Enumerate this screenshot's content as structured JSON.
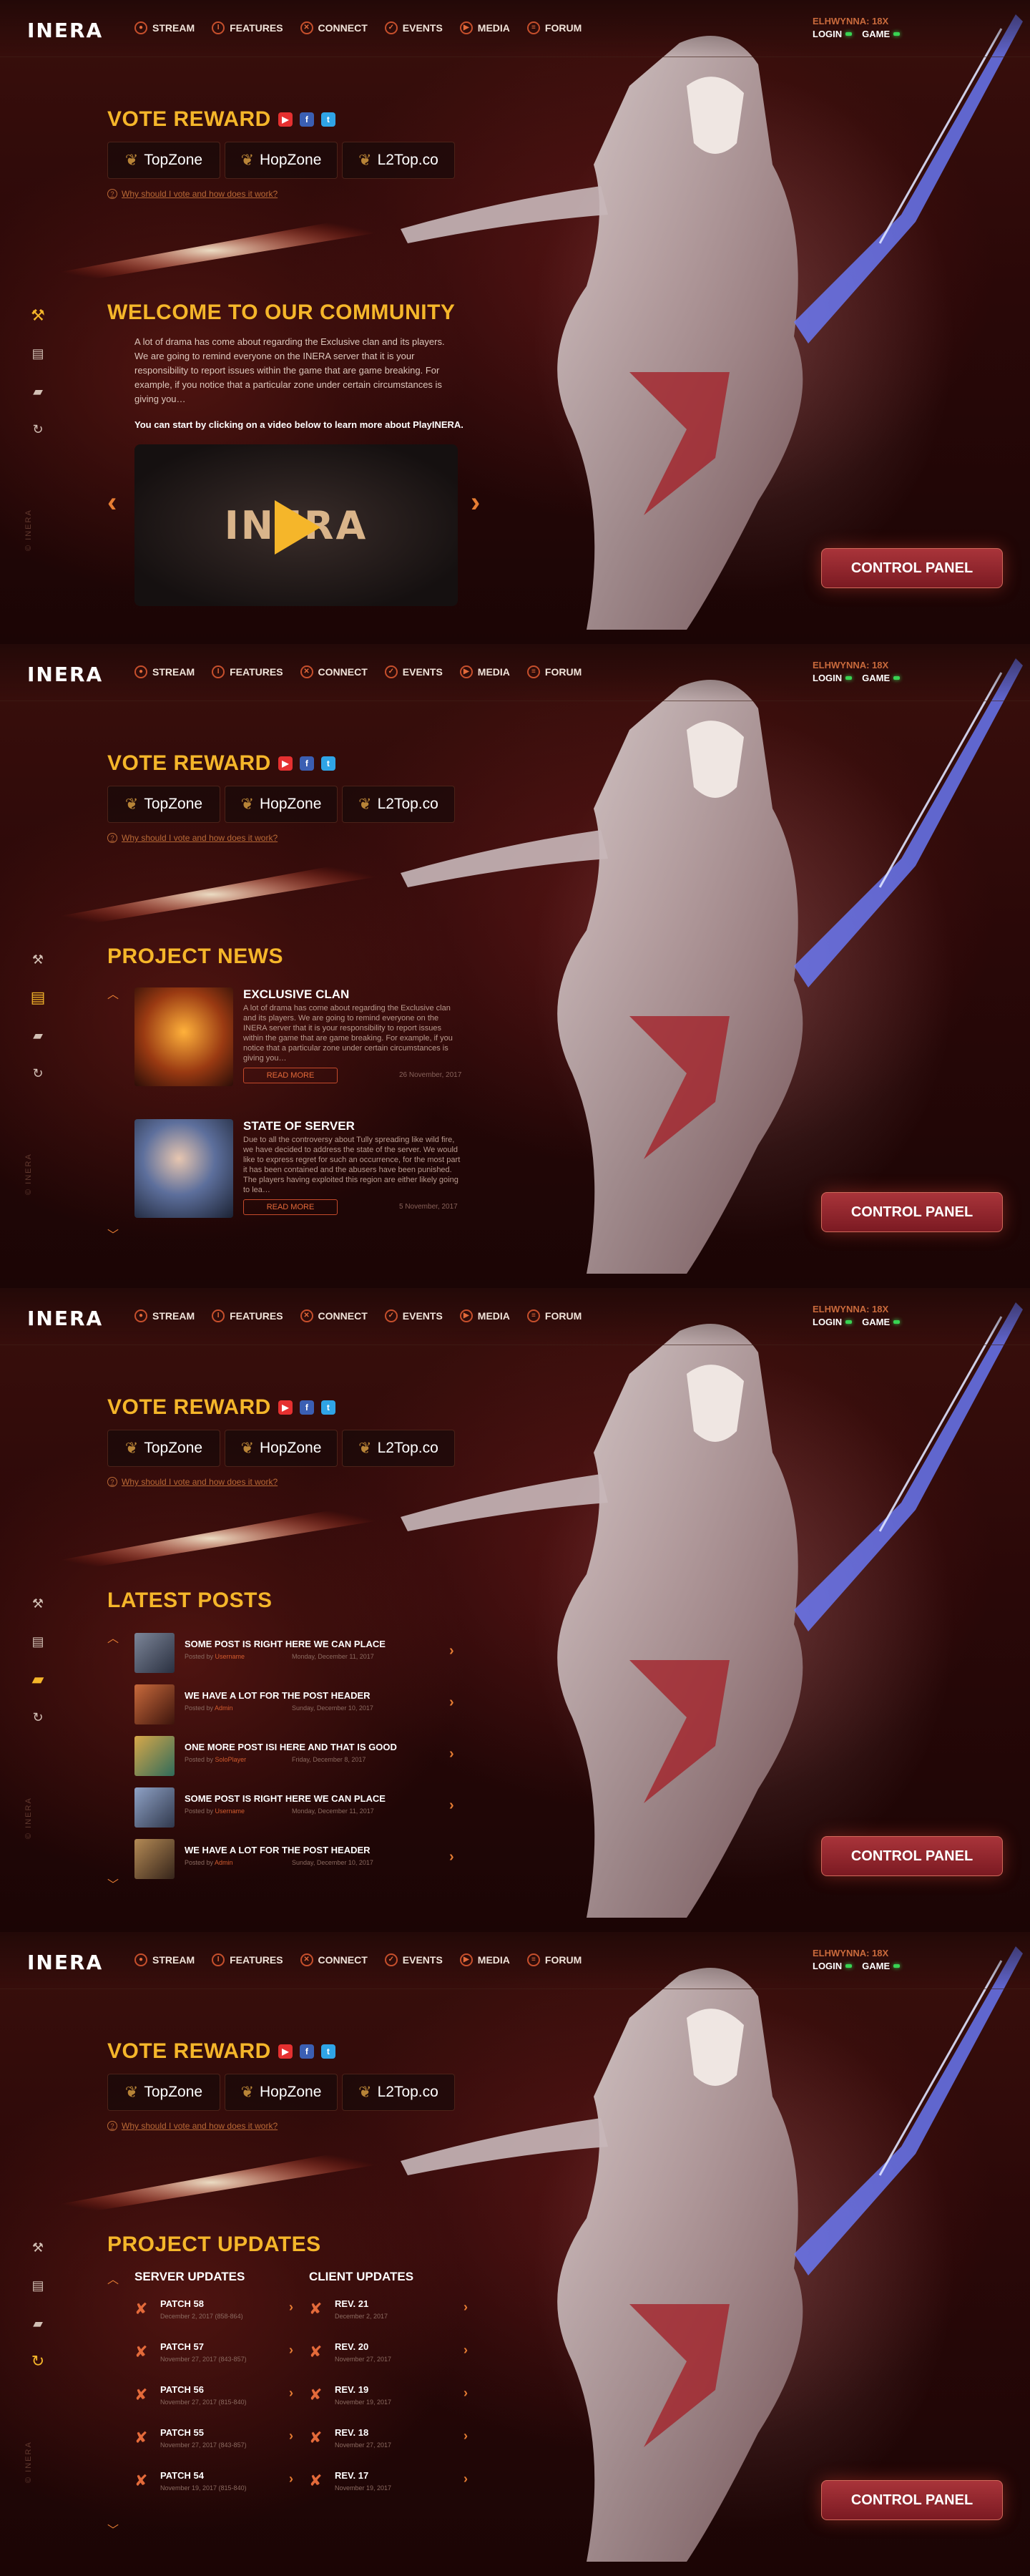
{
  "brand": {
    "logo": "INERA",
    "accent": "#f5b62a",
    "accent_orange": "#e67d33",
    "status_green": "#39d353"
  },
  "header": {
    "nav": [
      {
        "label": "STREAM",
        "icon": "stream-icon"
      },
      {
        "label": "FEATURES",
        "icon": "info-icon"
      },
      {
        "label": "CONNECT",
        "icon": "connect-icon"
      },
      {
        "label": "EVENTS",
        "icon": "events-icon"
      },
      {
        "label": "MEDIA",
        "icon": "media-icon"
      },
      {
        "label": "FORUM",
        "icon": "forum-icon"
      }
    ],
    "server": {
      "name": "ELHWYNNA: 18X",
      "login": "LOGIN",
      "game": "GAME"
    }
  },
  "vote": {
    "title": "VOTE REWARD",
    "sites": [
      "TopZone",
      "HopZone",
      "L2Top.co"
    ],
    "help": "Why should I vote and how does it work?"
  },
  "control_panel": "CONTROL PANEL",
  "copyright": "© INERA",
  "community": {
    "title": "WELCOME TO OUR COMMUNITY",
    "text": "A lot of drama has come about regarding the Exclusive clan and its players. We are going to remind everyone on the INERA server that it is your responsibility to report issues within the game that are game breaking. For example, if you notice that a particular zone under certain circumstances is giving you…",
    "cta": "You can start by clicking on a video below to learn more about PlayINERA.",
    "video_brand": "INERA"
  },
  "news": {
    "title": "PROJECT NEWS",
    "items": [
      {
        "title": "EXCLUSIVE CLAN",
        "text": "A lot of drama has come about regarding the Exclusive clan and its players. We are going to remind everyone on the INERA server that it is your responsibility to report issues within the game that are game breaking. For example, if you notice that a particular zone under certain circumstances is giving you…",
        "button": "READ MORE",
        "date": "26 November, 2017"
      },
      {
        "title": "STATE OF SERVER",
        "text": "Due to all the controversy about Tully spreading like wild fire, we have decided to address the state of the server. We would like to express regret for such an occurrence, for the most part it has been contained and the abusers have been punished. The players having exploited this region are either likely going to lea…",
        "button": "READ MORE",
        "date": "5 November, 2017"
      }
    ]
  },
  "posts": {
    "title": "LATEST POSTS",
    "posted_by": "Posted by",
    "items": [
      {
        "title": "SOME POST IS RIGHT HERE WE CAN PLACE",
        "author": "Username",
        "date": "Monday, December 11, 2017"
      },
      {
        "title": "WE HAVE A LOT FOR THE POST HEADER",
        "author": "Admin",
        "date": "Sunday, December 10, 2017"
      },
      {
        "title": "ONE MORE POST ISI HERE AND THAT IS GOOD",
        "author": "SoloPlayer",
        "date": "Friday, December 8, 2017"
      },
      {
        "title": "SOME POST IS RIGHT HERE WE CAN PLACE",
        "author": "Username",
        "date": "Monday, December 11, 2017"
      },
      {
        "title": "WE HAVE A LOT FOR THE POST HEADER",
        "author": "Admin",
        "date": "Sunday, December 10, 2017"
      }
    ]
  },
  "updates": {
    "title": "PROJECT UPDATES",
    "server_label": "SERVER UPDATES",
    "client_label": "CLIENT UPDATES",
    "server": [
      {
        "name": "PATCH 58",
        "date": "December 2, 2017 (858-864)"
      },
      {
        "name": "PATCH 57",
        "date": "November 27, 2017 (843-857)"
      },
      {
        "name": "PATCH 56",
        "date": "November 27, 2017 (815-840)"
      },
      {
        "name": "PATCH 55",
        "date": "November 27, 2017 (843-857)"
      },
      {
        "name": "PATCH 54",
        "date": "November 19, 2017 (815-840)"
      }
    ],
    "client": [
      {
        "name": "REV. 21",
        "date": "December 2, 2017"
      },
      {
        "name": "REV. 20",
        "date": "November 27, 2017"
      },
      {
        "name": "REV. 19",
        "date": "November 19, 2017"
      },
      {
        "name": "REV. 18",
        "date": "November 27, 2017"
      },
      {
        "name": "REV. 17",
        "date": "November 19, 2017"
      }
    ]
  }
}
